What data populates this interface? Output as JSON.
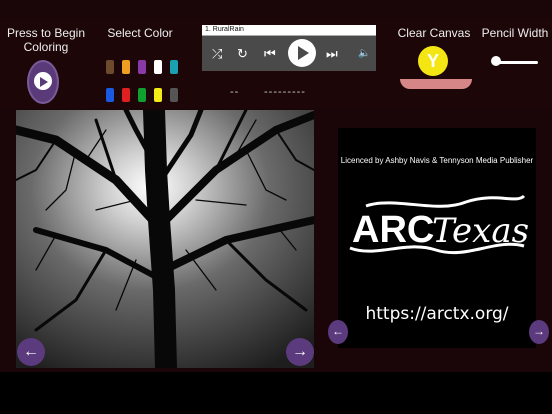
{
  "left_panel": {
    "begin_label": "Press to Begin\nColoring"
  },
  "colors": {
    "label": "Select Color",
    "row1": [
      "#6b4a2e",
      "#f0a020",
      "#8a3aa6",
      "#ffffff",
      "#1aa0b0"
    ],
    "row2": [
      "#1a5ae0",
      "#e02020",
      "#10a030",
      "#f4ea18",
      "#555555"
    ]
  },
  "player": {
    "track_title": "1. RuralRain",
    "display_left": "--",
    "display_right": "---------"
  },
  "clear": {
    "label": "Clear Canvas",
    "button_glyph": "Y"
  },
  "pencil": {
    "label": "Pencil Width",
    "level": 0.05
  },
  "canvas": {
    "prev_glyph": "←",
    "next_glyph": "→"
  },
  "license": {
    "text": "Licenced by Ashby Navis & Tennyson Media Publisher",
    "logo_text": "ARCTexas",
    "url": "https://arctx.org/",
    "prev_glyph": "←",
    "next_glyph": "→"
  }
}
